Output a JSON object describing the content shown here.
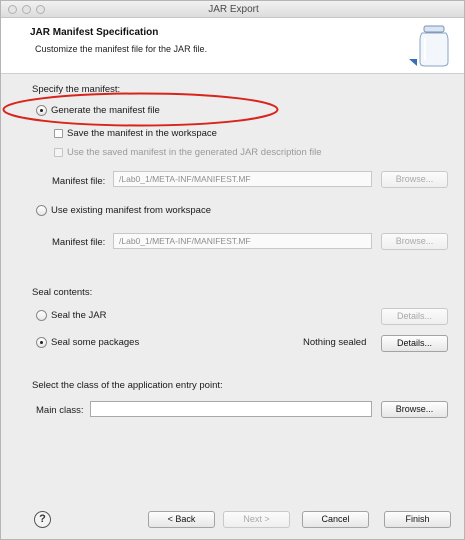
{
  "window": {
    "title": "JAR Export"
  },
  "header": {
    "title": "JAR Manifest Specification",
    "description": "Customize the manifest file for the JAR file.",
    "icon": "jar-icon"
  },
  "manifest": {
    "section_label": "Specify the manifest:",
    "generate_label": "Generate the manifest file",
    "save_label": "Save the manifest in the workspace",
    "use_saved_label": "Use the saved manifest in the generated JAR description file",
    "manifest_file_label": "Manifest file:",
    "generated_path": "/Lab0_1/META-INF/MANIFEST.MF",
    "browse_label": "Browse...",
    "existing_label": "Use existing manifest from workspace",
    "existing_path": "/Lab0_1/META-INF/MANIFEST.MF",
    "selected": "generate"
  },
  "seal": {
    "section_label": "Seal contents:",
    "seal_jar_label": "Seal the JAR",
    "seal_some_label": "Seal some packages",
    "status": "Nothing sealed",
    "details_label": "Details...",
    "selected": "seal_some"
  },
  "entry": {
    "section_label": "Select the class of the application entry point:",
    "main_class_label": "Main class:",
    "main_class_value": "",
    "browse_label": "Browse..."
  },
  "footer": {
    "help": "?",
    "back": "< Back",
    "next": "Next >",
    "cancel": "Cancel",
    "finish": "Finish"
  },
  "colors": {
    "annotation_oval": "#d9241c"
  }
}
